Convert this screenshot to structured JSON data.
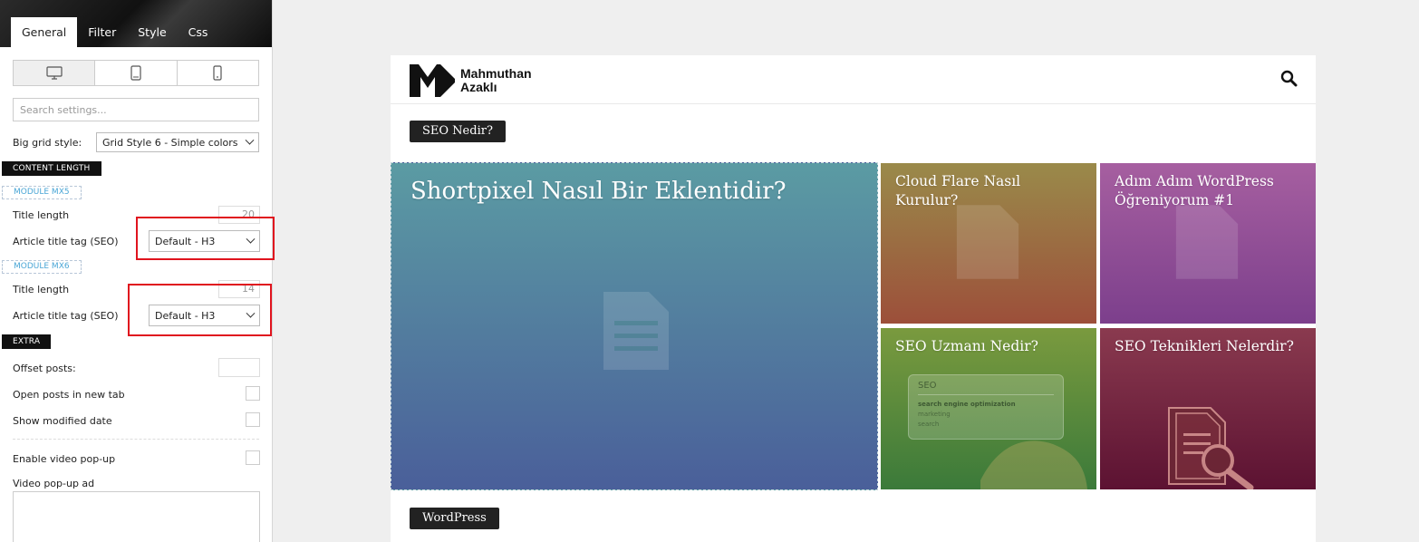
{
  "panel": {
    "tabs": [
      {
        "label": "General",
        "active": true
      },
      {
        "label": "Filter",
        "active": false
      },
      {
        "label": "Style",
        "active": false
      },
      {
        "label": "Css",
        "active": false
      }
    ],
    "devices": [
      "desktop-icon",
      "tablet-icon",
      "phone-icon"
    ],
    "search_placeholder": "Search settings...",
    "big_grid_style": {
      "label": "Big grid style:",
      "value": "Grid Style 6 - Simple colors"
    },
    "content_length_heading": "CONTENT LENGTH",
    "module_mx5": {
      "tag": "MODULE MX5",
      "title_length_label": "Title length",
      "title_length_value": "20",
      "title_tag_label": "Article title tag (SEO)",
      "title_tag_value": "Default - H3"
    },
    "module_mx6": {
      "tag": "MODULE MX6",
      "title_length_label": "Title length",
      "title_length_value": "14",
      "title_tag_label": "Article title tag (SEO)",
      "title_tag_value": "Default - H3"
    },
    "extra_heading": "EXTRA",
    "offset_posts_label": "Offset posts:",
    "open_new_tab_label": "Open posts in new tab",
    "show_modified_label": "Show modified date",
    "enable_video_label": "Enable video pop-up",
    "video_ad_label": "Video pop-up ad"
  },
  "site": {
    "logo_line1": "Mahmuthan",
    "logo_line2": "Azaklı",
    "category_top": "SEO Nedir?",
    "category_bottom": "WordPress",
    "tiles": [
      {
        "title": "Shortpixel Nasıl Bir Eklentidir?",
        "color_top": "#5b9ba3",
        "color_bottom": "#4a5f9a"
      },
      {
        "title": "Cloud Flare Nasıl Kurulur?",
        "color_top": "#9a8a4a",
        "color_bottom": "#9c4f3a"
      },
      {
        "title": "Adım Adım WordPress Öğreniyorum #1",
        "color_top": "#a65fa0",
        "color_bottom": "#7c3f8c"
      },
      {
        "title": "SEO Uzmanı Nedir?",
        "color_top": "#7a9a3e",
        "color_bottom": "#3b7a3a"
      },
      {
        "title": "SEO Teknikleri Nelerdir?",
        "color_top": "#8a3a4f",
        "color_bottom": "#5c1232"
      }
    ],
    "seo_thumb": {
      "heading": "SEO",
      "lines": [
        "search engine optimization",
        "marketing",
        "search"
      ]
    }
  }
}
